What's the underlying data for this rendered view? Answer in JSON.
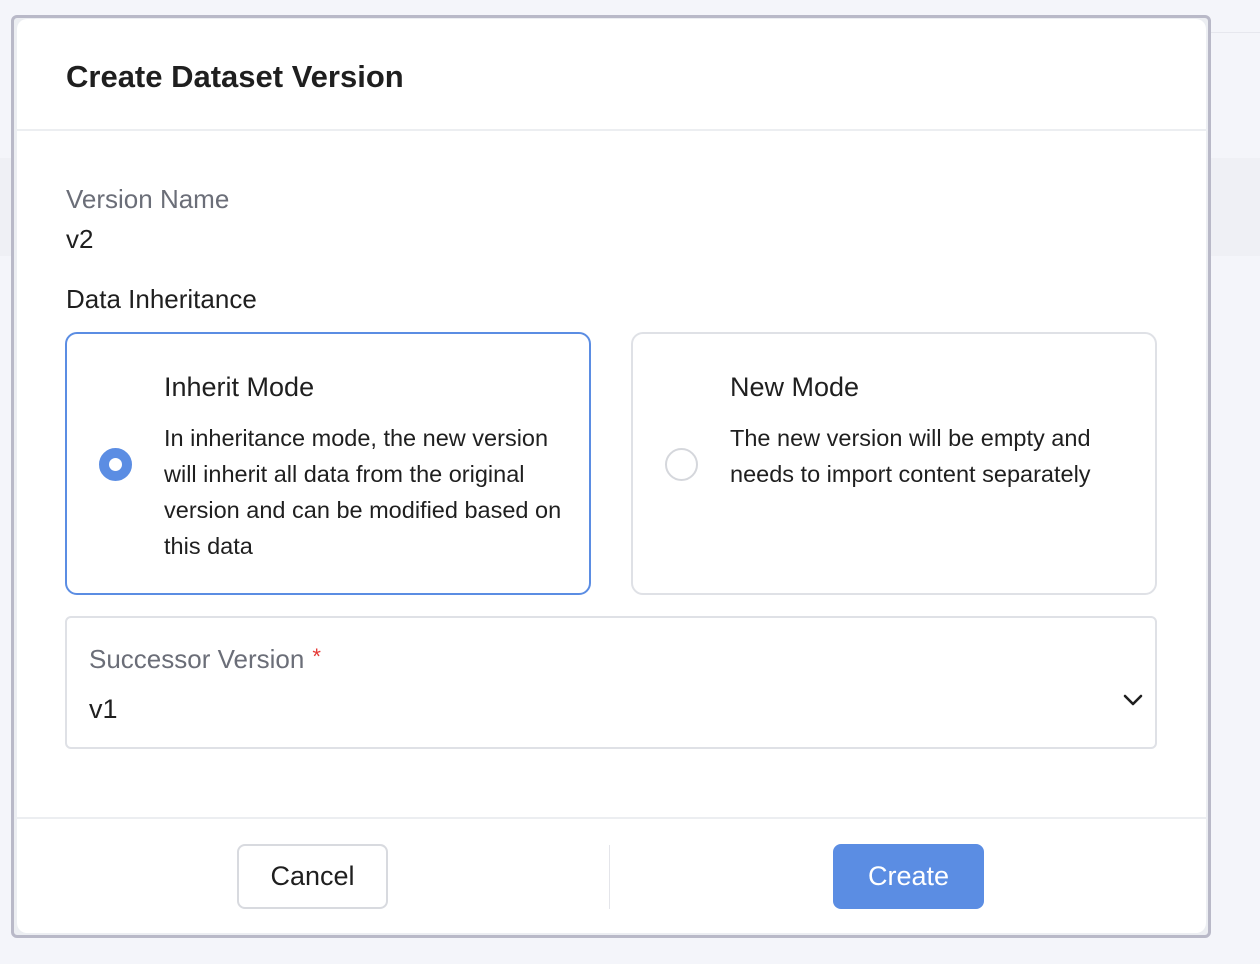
{
  "dialog": {
    "title": "Create Dataset Version",
    "version_name": {
      "label": "Version Name",
      "value": "v2"
    },
    "data_inheritance": {
      "label": "Data Inheritance",
      "options": [
        {
          "title": "Inherit Mode",
          "description": "In inheritance mode, the new version will inherit all data from the original version and can be modified based on this data",
          "selected": true
        },
        {
          "title": "New Mode",
          "description": "The new version will be empty and needs to import content separately",
          "selected": false
        }
      ]
    },
    "successor_version": {
      "label": "Successor Version",
      "required_mark": "*",
      "value": "v1"
    },
    "buttons": {
      "cancel": "Cancel",
      "create": "Create"
    }
  },
  "colors": {
    "accent": "#5b8de3",
    "required": "#e53935"
  }
}
